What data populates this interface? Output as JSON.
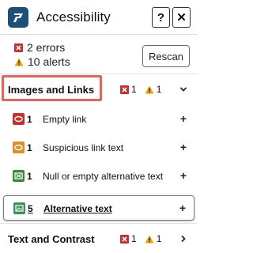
{
  "header": {
    "title": "Accessibility",
    "help_label": "?",
    "close_label": "✕"
  },
  "summary": {
    "errors_text": "2 errors",
    "alerts_text": "10 alerts",
    "rescan_label": "Rescan"
  },
  "sections": [
    {
      "label": "Images and Links",
      "errors": "1",
      "alerts": "1",
      "expanded": true,
      "items": [
        {
          "count": "1",
          "label": "Empty link",
          "icon": "broken-link-icon",
          "color": "#c9302c",
          "action": "+"
        },
        {
          "count": "1",
          "label": "Suspicious link text",
          "icon": "link-alert-icon",
          "color": "#e09020",
          "action": "+"
        },
        {
          "count": "1",
          "label": "Null or empty alternative text",
          "icon": "image-alt-icon",
          "color": "#3b8a3b",
          "action": "+"
        },
        {
          "count": "5",
          "label": "Alternative text",
          "icon": "image-icon",
          "color": "#3f8f5b",
          "action": "+"
        }
      ]
    },
    {
      "label": "Text and Contrast",
      "errors": "1",
      "alerts": "1",
      "expanded": false
    }
  ],
  "colors": {
    "error": "#c9302c",
    "alert": "#f0a500",
    "brand": "#1d4f7a",
    "highlight": "#e8625b"
  }
}
